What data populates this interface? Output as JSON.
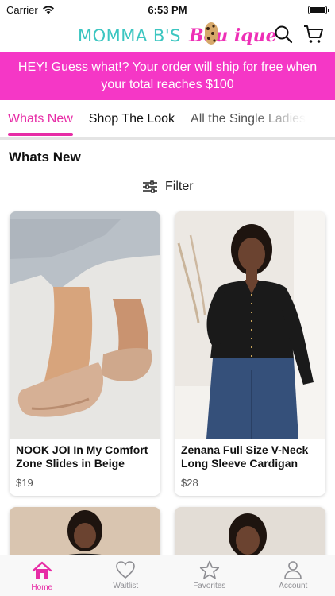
{
  "status_bar": {
    "carrier": "Carrier",
    "time": "6:53 PM"
  },
  "header": {
    "logo_left": "MOMMA B'S",
    "logo_right": "Bou  ique"
  },
  "promo": {
    "text": "HEY! Guess what!? Your order will ship for free when your total reaches $100"
  },
  "tabs": [
    {
      "label": "Whats New",
      "active": true
    },
    {
      "label": "Shop The Look",
      "active": false
    },
    {
      "label": "All the Single Ladies",
      "active": false
    }
  ],
  "section_title": "Whats New",
  "filter_label": "Filter",
  "products": [
    {
      "name": "NOOK JOI In My Comfort Zone Slides in Beige",
      "price": "$19"
    },
    {
      "name": "Zenana Full Size V-Neck Long Sleeve Cardigan",
      "price": "$28"
    }
  ],
  "tabbar": [
    {
      "label": "Home",
      "icon": "home-icon",
      "active": true
    },
    {
      "label": "Waitlist",
      "icon": "heart-icon",
      "active": false
    },
    {
      "label": "Favorites",
      "icon": "star-icon",
      "active": false
    },
    {
      "label": "Account",
      "icon": "person-icon",
      "active": false
    }
  ],
  "colors": {
    "accent": "#e72ca6",
    "promo_bg": "#f537c6",
    "logo_teal": "#3cc6c1"
  }
}
